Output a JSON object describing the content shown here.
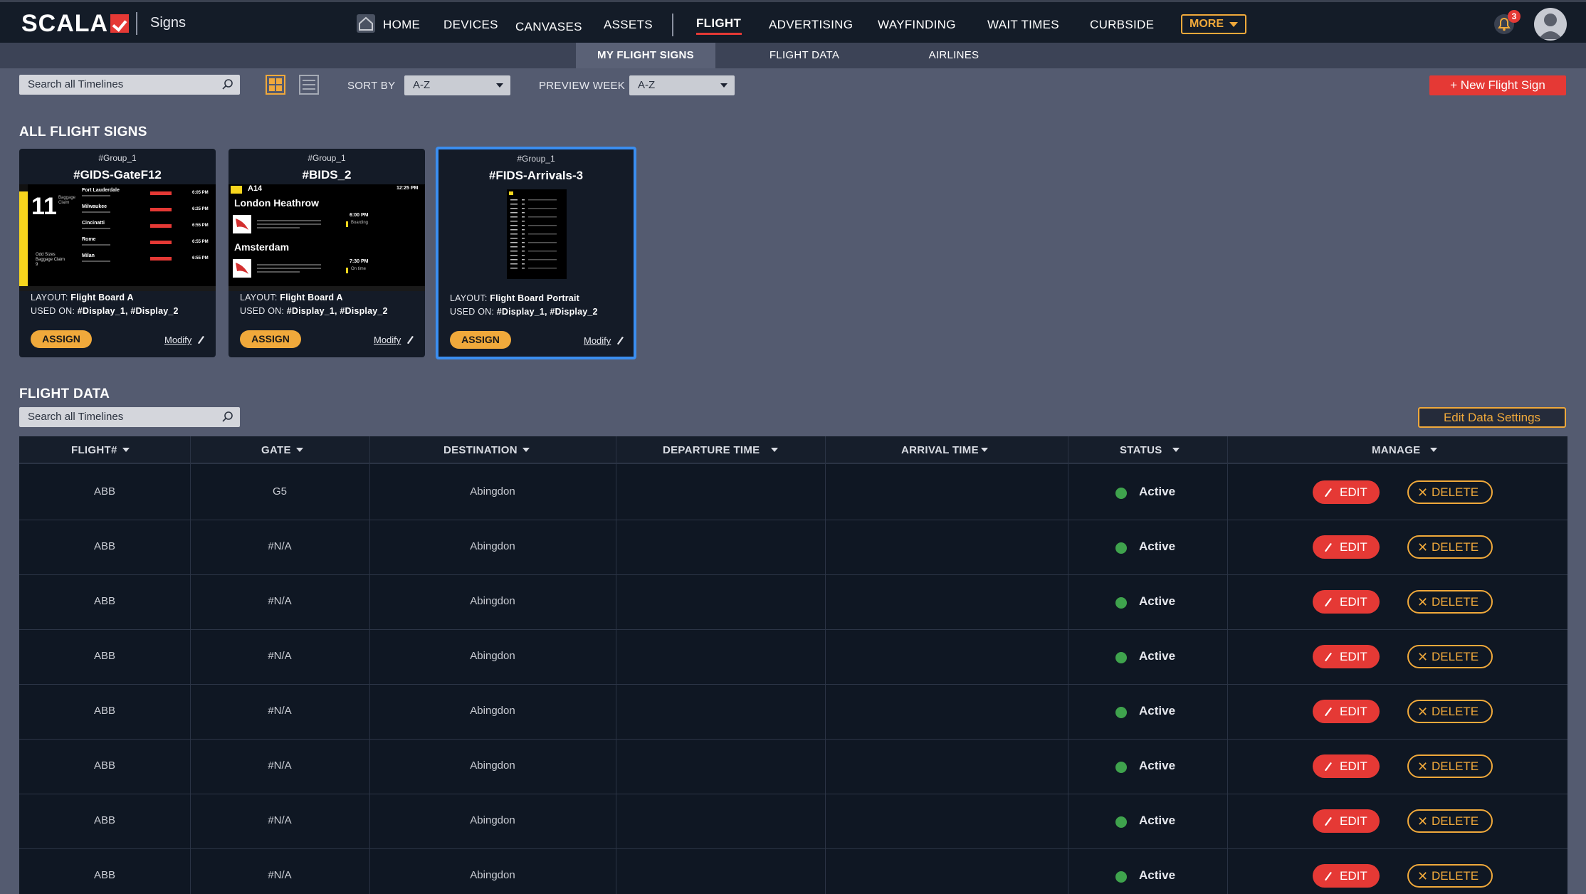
{
  "app": {
    "brand": "SCALA",
    "section": "Signs"
  },
  "nav": {
    "items": [
      "HOME",
      "DEVICES",
      "CANVASES",
      "ASSETS",
      "FLIGHT",
      "ADVERTISING",
      "WAYFINDING",
      "WAIT TIMES",
      "CURBSIDE"
    ],
    "more": "MORE",
    "notifications": "3"
  },
  "subnav": {
    "tabs": [
      "MY FLIGHT SIGNS",
      "FLIGHT DATA",
      "AIRLINES"
    ],
    "active": "MY FLIGHT SIGNS"
  },
  "toolbar": {
    "search_placeholder": "Search all Timelines",
    "sort_label": "SORT BY",
    "sort_value": "A-Z",
    "preview_label": "PREVIEW WEEK",
    "preview_value": "A-Z",
    "new_button": "+ New Flight Sign"
  },
  "signs_section": {
    "title": "ALL FLIGHT SIGNS",
    "layout_label": "LAYOUT:",
    "used_on_label": "USED ON:",
    "assign_label": "ASSIGN",
    "modify_label": "Modify",
    "cards": [
      {
        "group": "#Group_1",
        "name": "#GIDS-GateF12",
        "layout": "Flight Board A",
        "used_on": "#Display_1, #Display_2"
      },
      {
        "group": "#Group_1",
        "name": "#BIDS_2",
        "layout": "Flight Board A",
        "used_on": "#Display_1, #Display_2"
      },
      {
        "group": "#Group_1",
        "name": "#FIDS-Arrivals-3",
        "layout": "Flight Board Portrait",
        "used_on": "#Display_1, #Display_2"
      }
    ],
    "preview_gids": {
      "number": "11",
      "claim": "Baggage Claim",
      "odd": "Odd Sizes Baggage Claim 9",
      "cities": [
        "Fort Lauderdale",
        "Milwaukee",
        "Cincinatti",
        "Rome",
        "Milan"
      ],
      "times": [
        "6:05 PM",
        "6:25 PM",
        "6:55 PM",
        "6:55 PM",
        "6:55 PM"
      ]
    },
    "preview_bids": {
      "gate": "A14",
      "clock": "12:25 PM",
      "city1": "London Heathrow",
      "time1": "6:00 PM",
      "status1": "Boarding",
      "city2": "Amsterdam",
      "time2": "7:30 PM",
      "status2": "On time"
    }
  },
  "data_section": {
    "title": "FLIGHT DATA",
    "search_placeholder": "Search all Timelines",
    "edit_settings": "Edit Data Settings",
    "columns": [
      "FLIGHT#",
      "GATE",
      "DESTINATION",
      "DEPARTURE TIME",
      "ARRIVAL TIME",
      "STATUS",
      "MANAGE"
    ],
    "edit_label": "EDIT",
    "delete_label": "DELETE",
    "rows": [
      {
        "flight": "ABB",
        "gate": "G5",
        "destination": "Abingdon",
        "departure": "",
        "arrival": "",
        "status": "Active"
      },
      {
        "flight": "ABB",
        "gate": "#N/A",
        "destination": "Abingdon",
        "departure": "",
        "arrival": "",
        "status": "Active"
      },
      {
        "flight": "ABB",
        "gate": "#N/A",
        "destination": "Abingdon",
        "departure": "",
        "arrival": "",
        "status": "Active"
      },
      {
        "flight": "ABB",
        "gate": "#N/A",
        "destination": "Abingdon",
        "departure": "",
        "arrival": "",
        "status": "Active"
      },
      {
        "flight": "ABB",
        "gate": "#N/A",
        "destination": "Abingdon",
        "departure": "",
        "arrival": "",
        "status": "Active"
      },
      {
        "flight": "ABB",
        "gate": "#N/A",
        "destination": "Abingdon",
        "departure": "",
        "arrival": "",
        "status": "Active"
      },
      {
        "flight": "ABB",
        "gate": "#N/A",
        "destination": "Abingdon",
        "departure": "",
        "arrival": "",
        "status": "Active"
      },
      {
        "flight": "ABB",
        "gate": "#N/A",
        "destination": "Abingdon",
        "departure": "",
        "arrival": "",
        "status": "Active"
      }
    ]
  },
  "colors": {
    "accent": "#f0a93b",
    "danger": "#e53935",
    "active": "#3fa34d",
    "selected": "#3b8ef0"
  }
}
